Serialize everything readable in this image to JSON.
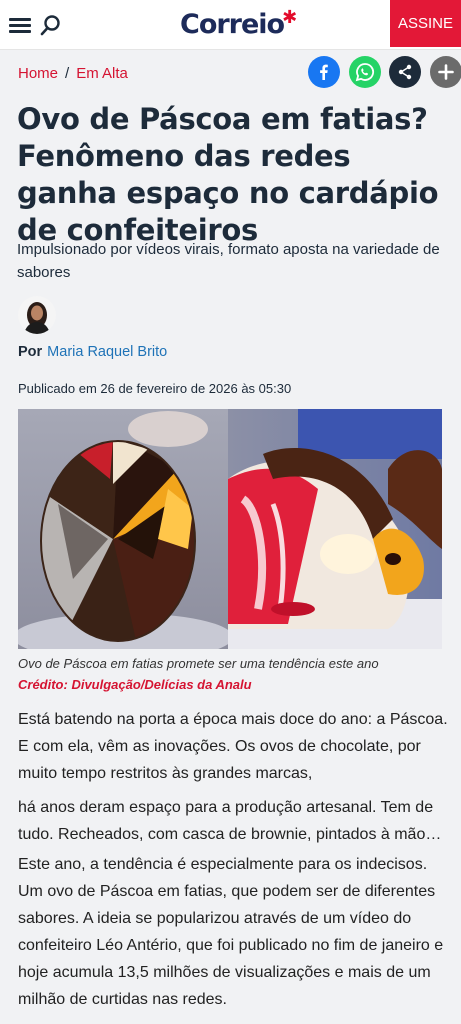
{
  "header": {
    "logo": "Correio",
    "subscribe_label": "ASSINE"
  },
  "breadcrumb": {
    "home": "Home",
    "section": "Em Alta"
  },
  "article": {
    "title": "Ovo de Páscoa em fatias? Fenômeno das redes ganha espaço no cardápio de confeiteiros",
    "subtitle": "Impulsionado por vídeos virais, formato aposta na variedade de sabores",
    "byline_prefix": "Por",
    "author": "Maria Raquel Brito",
    "published": "Publicado em 26 de fevereiro de 2026 às 05:30",
    "image_caption": "Ovo de Páscoa em fatias promete ser uma tendência este ano",
    "image_credit": "Crédito: Divulgação/Delícias da Analu",
    "paragraphs": [
      "Está batendo na porta a época mais doce do ano: a Páscoa. E com ela, vêm as inovações. Os ovos de chocolate, por muito tempo restritos às grandes marcas,",
      "há anos deram espaço para a produção artesanal. Tem de tudo. Recheados, com casca de brownie, pintados à mão…",
      "Este ano, a tendência é especialmente para os indecisos. Um ovo de Páscoa em fatias, que podem ser de diferentes sabores. A ideia se popularizou através de um vídeo do confeiteiro Léo Antério, que foi publicado no fim de janeiro e hoje acumula 13,5 milhões de visualizações e mais de um milhão de curtidas nas redes."
    ]
  },
  "share": {
    "icons": [
      "facebook-icon",
      "whatsapp-icon",
      "share-icon",
      "plus-icon"
    ],
    "colors": {
      "facebook": "#1877f2",
      "whatsapp": "#25d366",
      "share": "#1d2b3a",
      "more": "#6b6b6b"
    }
  },
  "colors": {
    "brand_red": "#e31837",
    "navy": "#1d2b3a",
    "link_blue": "#1f73b7"
  }
}
